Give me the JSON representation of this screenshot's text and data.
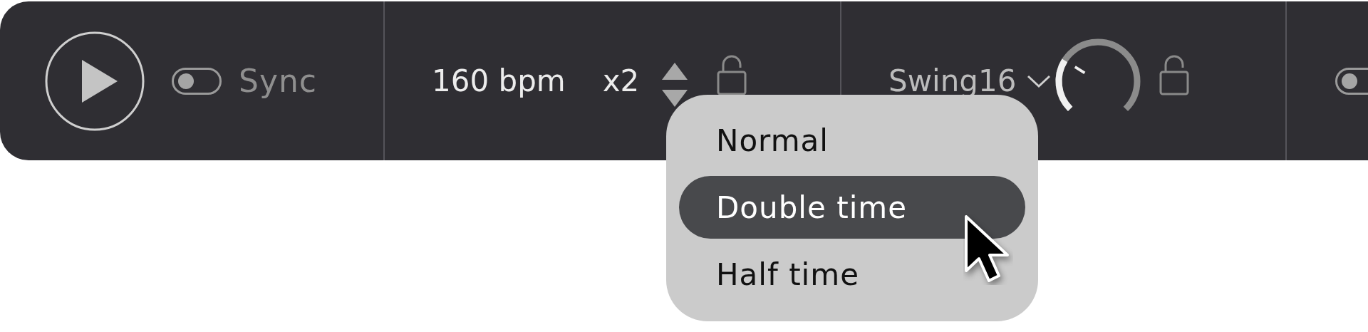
{
  "transport": {
    "playing": false
  },
  "sync": {
    "label": "Sync",
    "on": false
  },
  "tempo": {
    "value": "160 bpm",
    "multiplier": "x2",
    "locked": false
  },
  "swing": {
    "value": "Swing16",
    "locked": false
  },
  "extra_toggle": {
    "on": false
  },
  "menu": {
    "items": [
      {
        "label": "Normal",
        "selected": false
      },
      {
        "label": "Double time",
        "selected": true
      },
      {
        "label": "Half time",
        "selected": false
      }
    ]
  }
}
